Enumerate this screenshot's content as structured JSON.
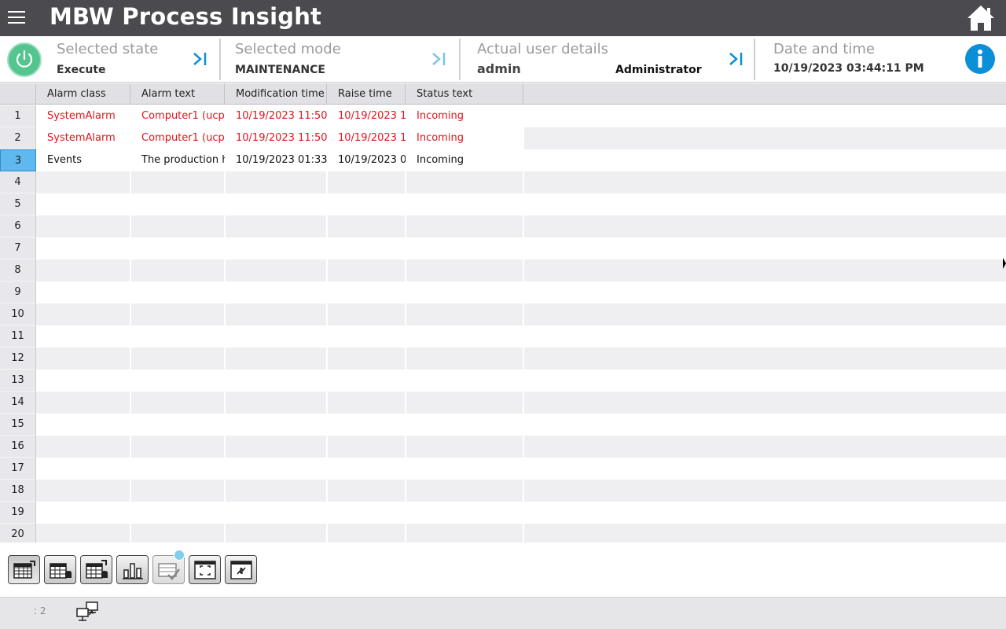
{
  "header": {
    "title": "MBW Process Insight",
    "menu_icon": "hamburger-menu-icon",
    "home_icon": "home-icon"
  },
  "status": {
    "state_label": "Selected state",
    "state_value": "Execute",
    "mode_label": "Selected mode",
    "mode_value": "MAINTENANCE",
    "user_label": "Actual user details",
    "user_name": "admin",
    "user_role": "Administrator",
    "datetime_label": "Date and time",
    "datetime_value": "10/19/2023 03:44:11 PM",
    "power_color": "#55c58f",
    "accent": "#0b8fd6"
  },
  "table": {
    "columns": [
      "Alarm class",
      "Alarm text",
      "Modification time",
      "Raise time",
      "Status text"
    ],
    "rows": [
      {
        "num": "1",
        "cells": [
          "SystemAlarm",
          "Computer1 (ucp-",
          "10/19/2023 11:50:",
          "10/19/2023 1",
          "Incoming"
        ],
        "color": "red"
      },
      {
        "num": "2",
        "cells": [
          "SystemAlarm",
          "Computer1 (ucp-",
          "10/19/2023 11:50:",
          "10/19/2023 1",
          "Incoming"
        ],
        "color": "red"
      },
      {
        "num": "3",
        "cells": [
          "Events",
          "The production h",
          "10/19/2023 01:33:",
          "10/19/2023 0",
          "Incoming"
        ],
        "color": "black",
        "selected": true
      },
      {
        "num": "4",
        "cells": [
          "",
          "",
          "",
          "",
          ""
        ]
      },
      {
        "num": "5",
        "cells": [
          "",
          "",
          "",
          "",
          ""
        ]
      },
      {
        "num": "6",
        "cells": [
          "",
          "",
          "",
          "",
          ""
        ]
      },
      {
        "num": "7",
        "cells": [
          "",
          "",
          "",
          "",
          ""
        ]
      },
      {
        "num": "8",
        "cells": [
          "",
          "",
          "",
          "",
          ""
        ]
      },
      {
        "num": "9",
        "cells": [
          "",
          "",
          "",
          "",
          ""
        ]
      },
      {
        "num": "10",
        "cells": [
          "",
          "",
          "",
          "",
          ""
        ]
      },
      {
        "num": "11",
        "cells": [
          "",
          "",
          "",
          "",
          ""
        ]
      },
      {
        "num": "12",
        "cells": [
          "",
          "",
          "",
          "",
          ""
        ]
      },
      {
        "num": "13",
        "cells": [
          "",
          "",
          "",
          "",
          ""
        ]
      },
      {
        "num": "14",
        "cells": [
          "",
          "",
          "",
          "",
          ""
        ]
      },
      {
        "num": "15",
        "cells": [
          "",
          "",
          "",
          "",
          ""
        ]
      },
      {
        "num": "16",
        "cells": [
          "",
          "",
          "",
          "",
          ""
        ]
      },
      {
        "num": "17",
        "cells": [
          "",
          "",
          "",
          "",
          ""
        ]
      },
      {
        "num": "18",
        "cells": [
          "",
          "",
          "",
          "",
          ""
        ]
      },
      {
        "num": "19",
        "cells": [
          "",
          "",
          "",
          "",
          ""
        ]
      },
      {
        "num": "20",
        "cells": [
          "",
          "",
          "",
          "",
          ""
        ]
      }
    ],
    "alarm_color": "#e3141c",
    "selected_color": "#5fb8ee"
  },
  "toolbar": {
    "buttons": [
      {
        "name": "current-alarms-icon"
      },
      {
        "name": "alarm-archive-icon"
      },
      {
        "name": "alarm-history-icon"
      },
      {
        "name": "alarm-statistics-icon"
      },
      {
        "name": "acknowledge-icon"
      },
      {
        "name": "select-visible-icon"
      },
      {
        "name": "loop-in-alarm-icon"
      }
    ]
  },
  "footer": {
    "text": ": 2",
    "network_icon": "network-connection-icon"
  }
}
